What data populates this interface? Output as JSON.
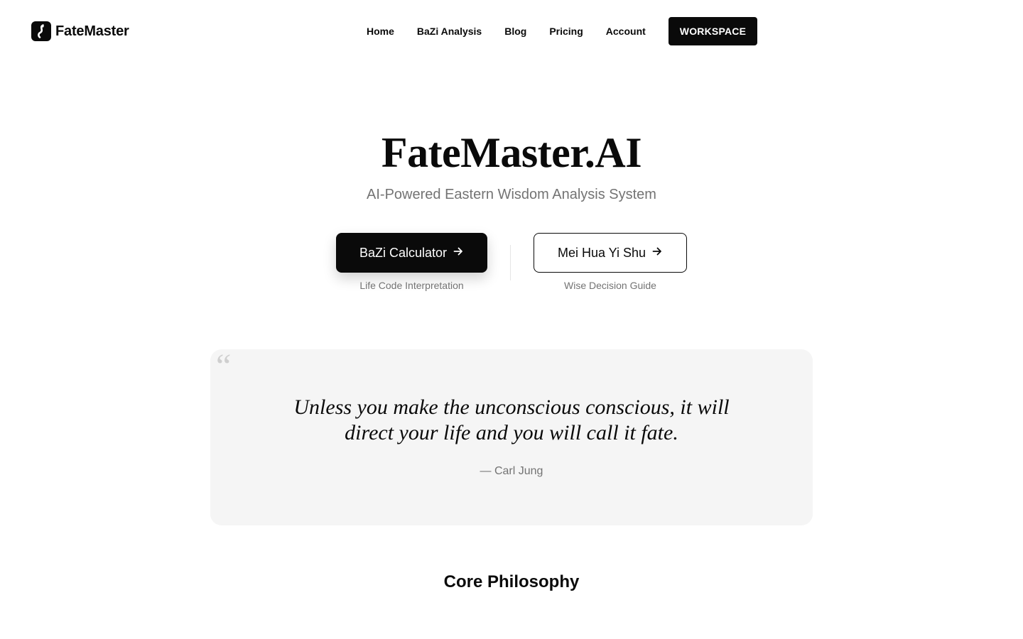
{
  "brand": {
    "name": "FateMaster",
    "logo_icon": "yin-yang-swirl-icon"
  },
  "nav": {
    "items": [
      {
        "label": "Home"
      },
      {
        "label": "BaZi Analysis"
      },
      {
        "label": "Blog"
      },
      {
        "label": "Pricing"
      },
      {
        "label": "Account"
      }
    ],
    "cta_label": "WORKSPACE"
  },
  "hero": {
    "title": "FateMaster.AI",
    "subtitle": "AI-Powered Eastern Wisdom Analysis System",
    "primary_cta": {
      "label": "BaZi Calculator",
      "caption": "Life Code Interpretation",
      "icon": "arrow-right-icon"
    },
    "secondary_cta": {
      "label": "Mei Hua Yi Shu",
      "caption": "Wise Decision Guide",
      "icon": "arrow-right-icon"
    }
  },
  "quote": {
    "mark": "“",
    "text": "Unless you make the unconscious conscious, it will direct your life and you will call it fate.",
    "author": "— Carl Jung"
  },
  "sections": {
    "core_title": "Core Philosophy"
  },
  "colors": {
    "primary": "#0a0a0a",
    "muted_text": "#737373",
    "card_bg": "#f5f5f5",
    "background": "#ffffff"
  }
}
